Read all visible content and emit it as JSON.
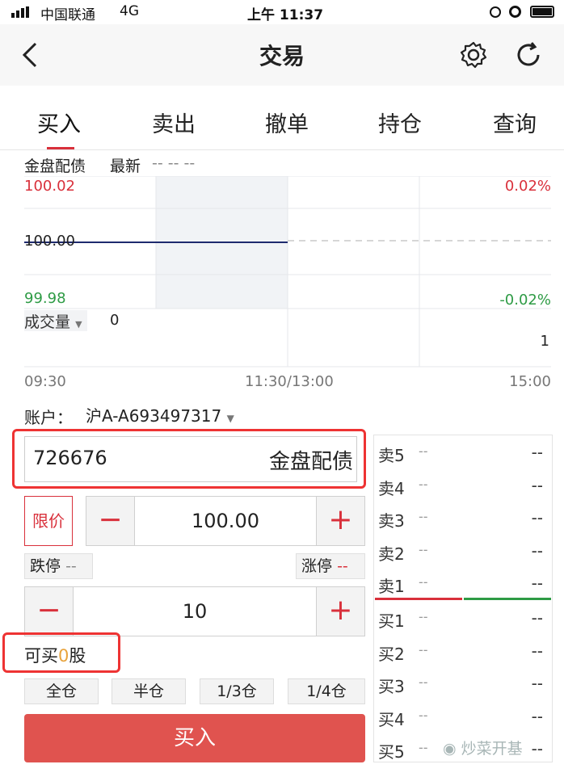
{
  "status": {
    "carrier": "中国联通",
    "network": "4G",
    "time": "上午 11:37"
  },
  "nav": {
    "title": "交易",
    "back_icon": "chevron-left-icon",
    "settings_icon": "gear-icon",
    "refresh_icon": "refresh-icon"
  },
  "tabs": [
    "买入",
    "卖出",
    "撤单",
    "持仓",
    "查询"
  ],
  "quote": {
    "name": "金盘配债",
    "latest_label": "最新",
    "latest_value": "-- -- --"
  },
  "chart_data": {
    "type": "line",
    "y_top": "100.02",
    "y_mid": "100.00",
    "y_bottom": "99.98",
    "pct_top": "0.02%",
    "pct_bottom": "-0.02%",
    "volume_label": "成交量",
    "volume_value": "0",
    "volume_right": "1",
    "x_labels": [
      "09:30",
      "11:30/13:00",
      "15:00"
    ],
    "series": [
      {
        "values": [
          100.0,
          100.0
        ]
      }
    ],
    "colors": {
      "up": "#d9303b",
      "down": "#2e9b45",
      "line": "#1e2a6e"
    }
  },
  "account": {
    "label": "账户：",
    "value": "沪A-A693497317"
  },
  "stock": {
    "code": "726676",
    "name": "金盘配债"
  },
  "price": {
    "type": "限价",
    "value": "100.00",
    "minus": "−",
    "plus": "+"
  },
  "limits": {
    "down_label": "跌停",
    "down_value": "--",
    "up_label": "涨停",
    "up_value": "--"
  },
  "qty": {
    "value": "10",
    "minus": "−",
    "plus": "+"
  },
  "buyable": {
    "prefix": "可买",
    "count": "0",
    "suffix": "股"
  },
  "positions": [
    "全仓",
    "半仓",
    "1/3仓",
    "1/4仓"
  ],
  "submit": "买入",
  "orderbook": {
    "sell": [
      {
        "label": "卖5",
        "price": "--",
        "vol": "--"
      },
      {
        "label": "卖4",
        "price": "--",
        "vol": "--"
      },
      {
        "label": "卖3",
        "price": "--",
        "vol": "--"
      },
      {
        "label": "卖2",
        "price": "--",
        "vol": "--"
      },
      {
        "label": "卖1",
        "price": "--",
        "vol": "--"
      }
    ],
    "buy": [
      {
        "label": "买1",
        "price": "--",
        "vol": "--"
      },
      {
        "label": "买2",
        "price": "--",
        "vol": "--"
      },
      {
        "label": "买3",
        "price": "--",
        "vol": "--"
      },
      {
        "label": "买4",
        "price": "--",
        "vol": "--"
      },
      {
        "label": "买5",
        "price": "--",
        "vol": "--"
      }
    ]
  },
  "watermark": "炒菜开基"
}
